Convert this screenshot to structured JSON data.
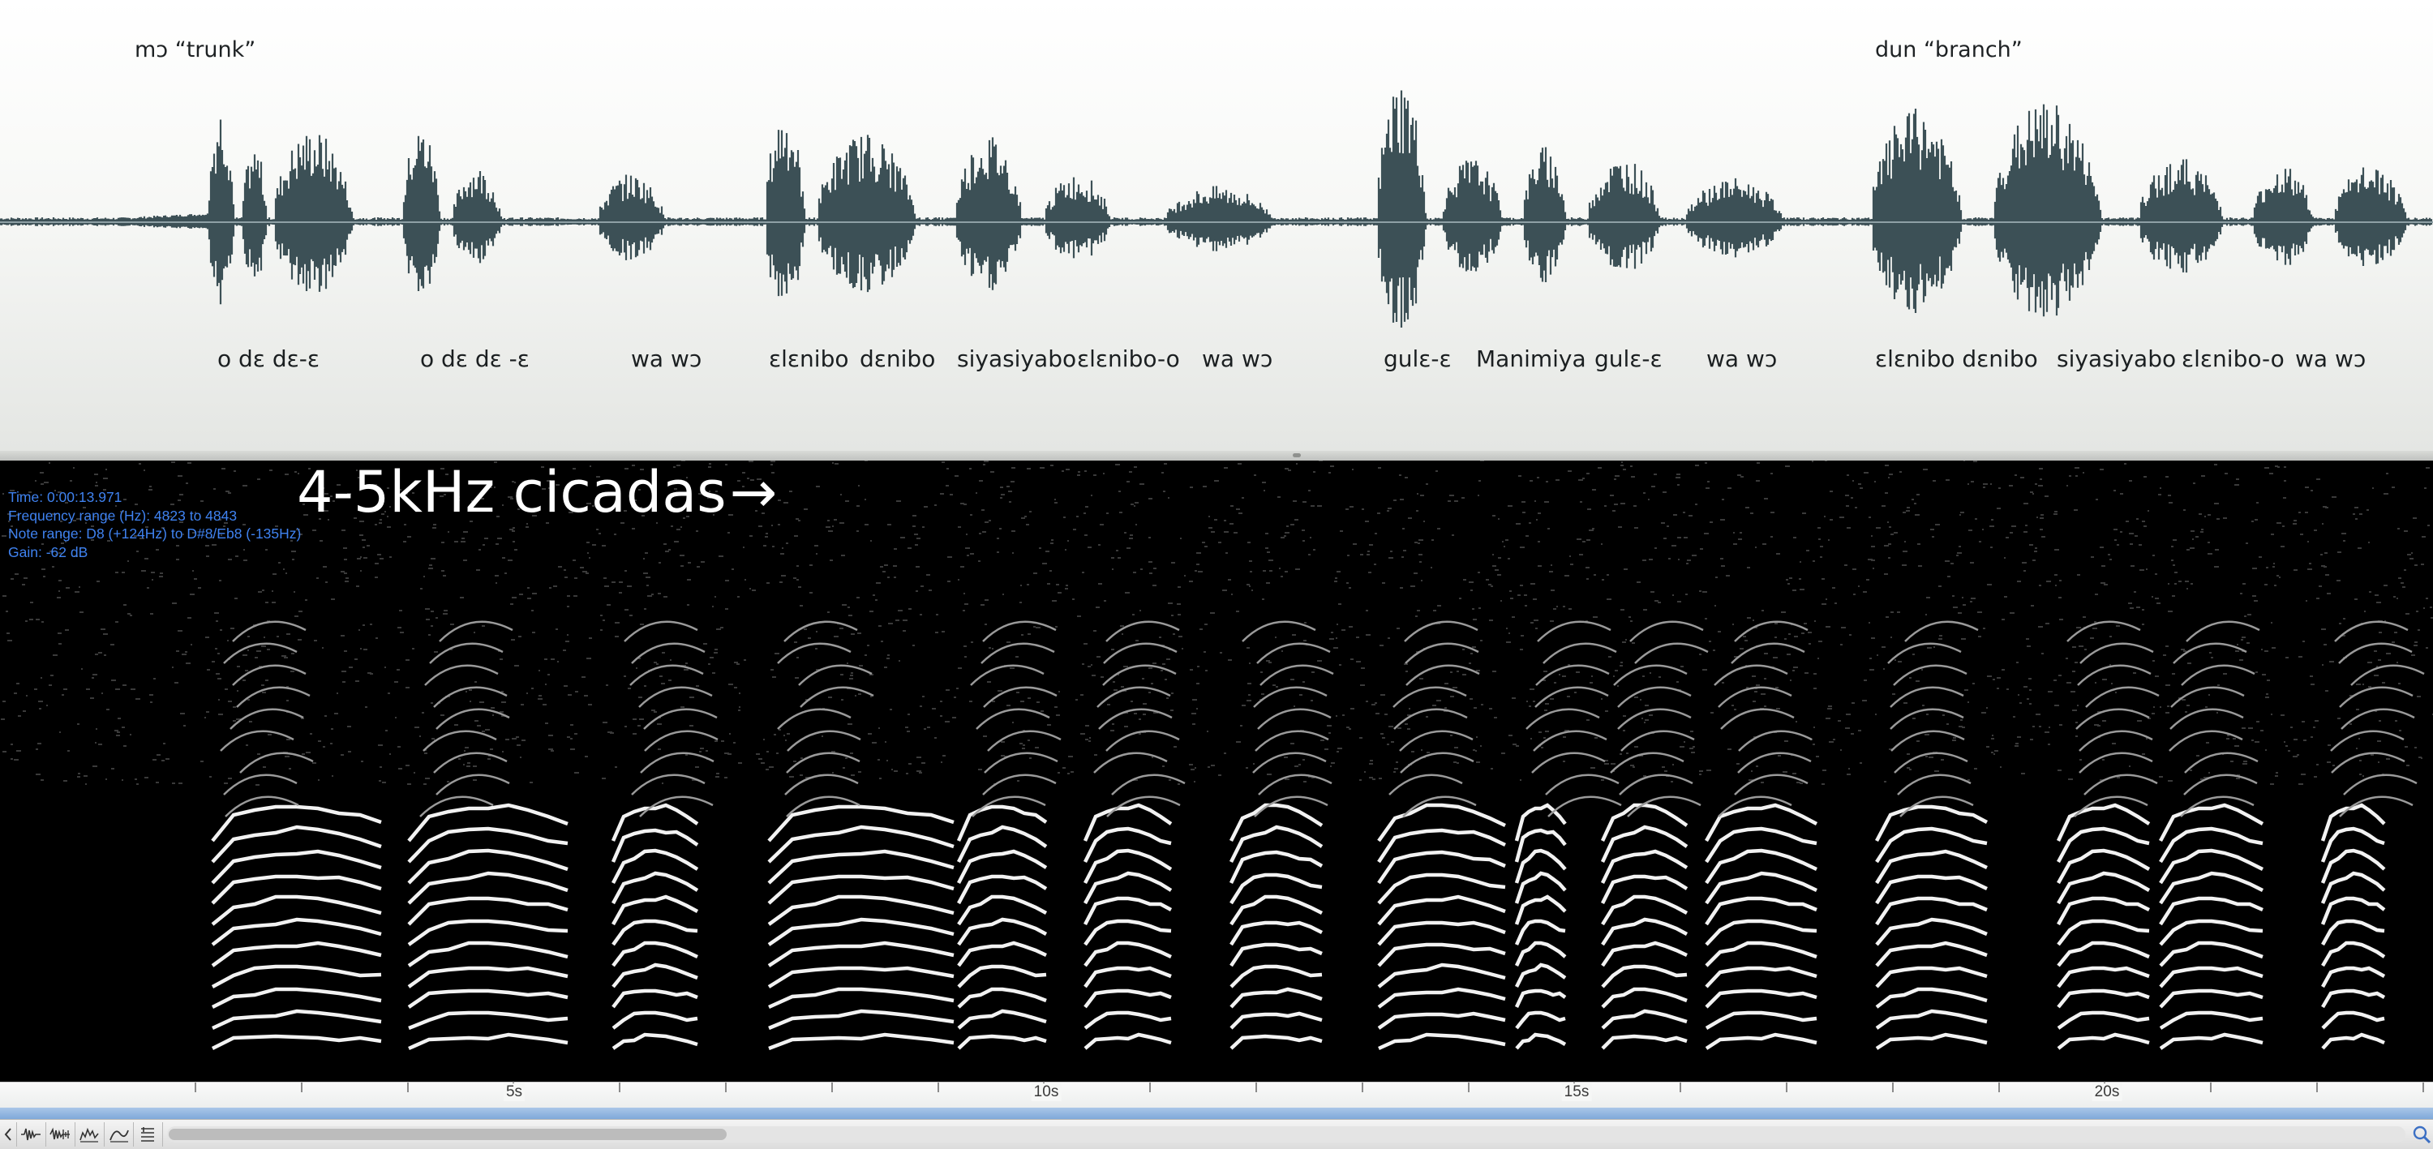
{
  "waveform": {
    "phrase_labels": [
      "mɔ “trunk”",
      "dun “branch”"
    ],
    "words": [
      "o dɛ dɛ-ɛ",
      "o dɛ dɛ -ɛ",
      "wa wɔ",
      "ɛlɛnibo",
      "dɛnibo",
      "siyasiyabo",
      "ɛlɛnibo-o",
      "wa wɔ",
      "gulɛ-ɛ",
      "Manimiya",
      "gulɛ-ɛ",
      "wa wɔ",
      "ɛlɛnibo dɛnibo",
      "siyasiyabo",
      "ɛlɛnibo-o",
      "wa wɔ"
    ],
    "color": "#3c5056"
  },
  "spectrogram": {
    "readout": {
      "time": "Time: 0:00:13.971",
      "frequency_range": "Frequency range (Hz): 4823 to 4843",
      "note_range": "Note range: D8 (+124Hz) to D#8/Eb8 (-135Hz)",
      "gain": "Gain: -62 dB"
    },
    "annotation": "4-5kHz cicadas",
    "annotation_arrow": "→",
    "readout_color": "#3f82f0"
  },
  "timeline": {
    "tick_labels": [
      "5s",
      "10s",
      "15s",
      "20s"
    ]
  },
  "toolbar": {
    "tools": [
      "waveform-view-icon",
      "waveform-spectrum-icon",
      "spectrum-view-icon",
      "pitch-trace-icon",
      "level-meter-icon"
    ],
    "zoom_icon": "magnifier-icon"
  }
}
